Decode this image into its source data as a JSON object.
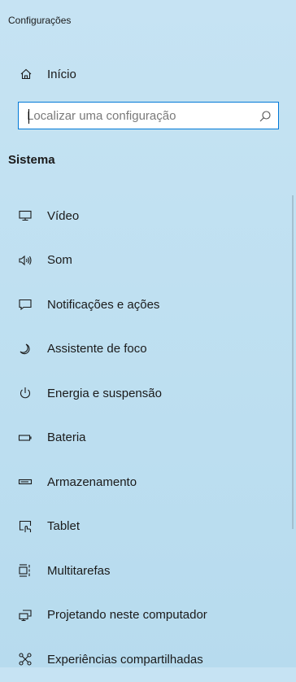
{
  "window": {
    "title": "Configurações"
  },
  "home": {
    "label": "Início",
    "icon": "home-icon"
  },
  "search": {
    "placeholder": "Localizar uma configuração",
    "icon": "search-icon"
  },
  "section": {
    "title": "Sistema"
  },
  "nav": {
    "items": [
      {
        "label": "Vídeo",
        "icon": "monitor-icon"
      },
      {
        "label": "Som",
        "icon": "speaker-icon"
      },
      {
        "label": "Notificações e ações",
        "icon": "notification-icon"
      },
      {
        "label": "Assistente de foco",
        "icon": "moon-icon"
      },
      {
        "label": "Energia e suspensão",
        "icon": "power-icon"
      },
      {
        "label": "Bateria",
        "icon": "battery-icon"
      },
      {
        "label": "Armazenamento",
        "icon": "storage-icon"
      },
      {
        "label": "Tablet",
        "icon": "tablet-icon"
      },
      {
        "label": "Multitarefas",
        "icon": "multitasking-icon"
      },
      {
        "label": "Projetando neste computador",
        "icon": "projecting-icon"
      },
      {
        "label": "Experiências compartilhadas",
        "icon": "shared-experiences-icon"
      }
    ]
  }
}
